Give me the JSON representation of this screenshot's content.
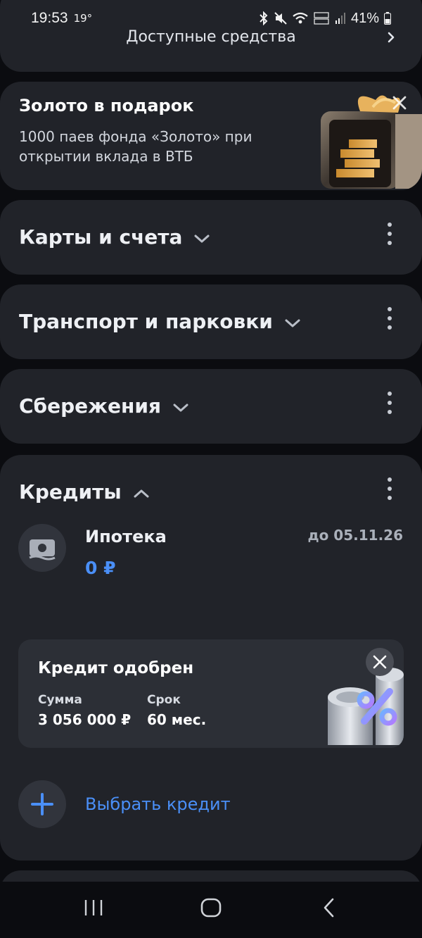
{
  "status_bar": {
    "time": "19:53",
    "temperature": "19°",
    "battery": "41%"
  },
  "top_card": {
    "title": "Доступные средства"
  },
  "promo": {
    "title": "Золото в подарок",
    "text": "1000 паев фонда «Золото» при открытии вклада в ВТБ"
  },
  "sections": [
    {
      "title": "Карты и счета"
    },
    {
      "title": "Транспорт и парковки"
    },
    {
      "title": "Сбережения"
    }
  ],
  "credits": {
    "title": "Кредиты",
    "mortgage": {
      "name": "Ипотека",
      "amount": "0 ₽",
      "until": "до 05.11.26"
    },
    "approved": {
      "title": "Кредит одобрен",
      "amount_label": "Сумма",
      "amount_value": "3 056 000 ₽",
      "term_label": "Срок",
      "term_value": "60 мес."
    },
    "choose_label": "Выбрать кредит"
  },
  "colors": {
    "background": "#0b0c10",
    "card": "#212329",
    "accent_blue": "#4a8ff7"
  }
}
